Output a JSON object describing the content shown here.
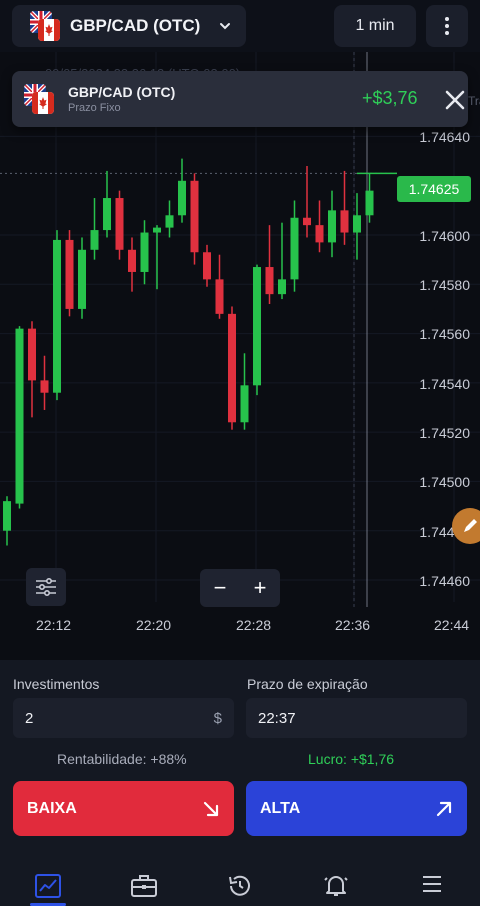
{
  "topbar": {
    "pair_title": "GBP/CAD (OTC)",
    "timeframe": "1 min",
    "icons": {
      "flags": [
        "uk-flag-icon",
        "canada-flag-icon"
      ],
      "dropdown": "chevron-down-icon",
      "more": "kebab-menu-icon"
    }
  },
  "notification": {
    "pair": "GBP/CAD (OTC)",
    "subtitle": "Prazo Fixo",
    "profit": "+$3,76",
    "faded_header": "09/05/2024 22:36:12 (UTC-03:00)",
    "faded_side": "Tra"
  },
  "chart": {
    "current_price": "1.74625",
    "y_ticks": [
      "1.74640",
      "1.74600",
      "1.74580",
      "1.74560",
      "1.74540",
      "1.74520",
      "1.74500",
      "1.74480",
      "1.74460"
    ],
    "x_ticks": [
      "22:12",
      "22:20",
      "22:28",
      "22:36",
      "22:44"
    ],
    "colors": {
      "up": "#27c24c",
      "down": "#e0313f",
      "price_tag": "#2ab94b"
    },
    "candles": [
      {
        "o": 1.7448,
        "c": 1.74492,
        "h": 1.74494,
        "l": 1.74474
      },
      {
        "o": 1.74491,
        "c": 1.74562,
        "h": 1.74563,
        "l": 1.74489
      },
      {
        "o": 1.74562,
        "c": 1.74541,
        "h": 1.74565,
        "l": 1.74526
      },
      {
        "o": 1.74541,
        "c": 1.74536,
        "h": 1.74551,
        "l": 1.74529
      },
      {
        "o": 1.74536,
        "c": 1.74598,
        "h": 1.74602,
        "l": 1.74533
      },
      {
        "o": 1.74598,
        "c": 1.7457,
        "h": 1.74602,
        "l": 1.74567
      },
      {
        "o": 1.7457,
        "c": 1.74594,
        "h": 1.74599,
        "l": 1.74566
      },
      {
        "o": 1.74594,
        "c": 1.74602,
        "h": 1.74615,
        "l": 1.7459
      },
      {
        "o": 1.74602,
        "c": 1.74615,
        "h": 1.74626,
        "l": 1.74599
      },
      {
        "o": 1.74615,
        "c": 1.74594,
        "h": 1.74618,
        "l": 1.7459
      },
      {
        "o": 1.74594,
        "c": 1.74585,
        "h": 1.74599,
        "l": 1.74577
      },
      {
        "o": 1.74585,
        "c": 1.74601,
        "h": 1.74606,
        "l": 1.7458
      },
      {
        "o": 1.74601,
        "c": 1.74603,
        "h": 1.74604,
        "l": 1.74578
      },
      {
        "o": 1.74603,
        "c": 1.74608,
        "h": 1.74614,
        "l": 1.74599
      },
      {
        "o": 1.74608,
        "c": 1.74622,
        "h": 1.74631,
        "l": 1.74605
      },
      {
        "o": 1.74622,
        "c": 1.74593,
        "h": 1.74625,
        "l": 1.74588
      },
      {
        "o": 1.74593,
        "c": 1.74582,
        "h": 1.74596,
        "l": 1.74579
      },
      {
        "o": 1.74582,
        "c": 1.74568,
        "h": 1.74592,
        "l": 1.74566
      },
      {
        "o": 1.74568,
        "c": 1.74524,
        "h": 1.74571,
        "l": 1.74521
      },
      {
        "o": 1.74524,
        "c": 1.74539,
        "h": 1.74552,
        "l": 1.74521
      },
      {
        "o": 1.74539,
        "c": 1.74587,
        "h": 1.74588,
        "l": 1.74535
      },
      {
        "o": 1.74587,
        "c": 1.74576,
        "h": 1.74604,
        "l": 1.74572
      },
      {
        "o": 1.74576,
        "c": 1.74582,
        "h": 1.74605,
        "l": 1.74574
      },
      {
        "o": 1.74582,
        "c": 1.74607,
        "h": 1.74614,
        "l": 1.74577
      },
      {
        "o": 1.74607,
        "c": 1.74604,
        "h": 1.74628,
        "l": 1.74599
      },
      {
        "o": 1.74604,
        "c": 1.74597,
        "h": 1.74614,
        "l": 1.74593
      },
      {
        "o": 1.74597,
        "c": 1.7461,
        "h": 1.74618,
        "l": 1.74591
      },
      {
        "o": 1.7461,
        "c": 1.74601,
        "h": 1.74626,
        "l": 1.74596
      },
      {
        "o": 1.74601,
        "c": 1.74608,
        "h": 1.74617,
        "l": 1.7459
      },
      {
        "o": 1.74608,
        "c": 1.74618,
        "h": 1.74625,
        "l": 1.74605
      }
    ]
  },
  "controls": {
    "zoom_out": "−",
    "zoom_in": "+"
  },
  "trade": {
    "investment_label": "Investimentos",
    "investment_value": "2",
    "investment_suffix": "$",
    "expiry_label": "Prazo de expiração",
    "expiry_value": "22:37",
    "profitability_label": "Rentabilidade:",
    "profitability_value": "+88%",
    "profit_label": "Lucro:",
    "profit_value": "+$1,76",
    "sell_label": "BAIXA",
    "buy_label": "ALTA",
    "colors": {
      "sell": "#e12b3c",
      "buy": "#2b43d8",
      "profit": "#2fcf58"
    }
  },
  "bottom_nav": [
    {
      "icon": "chart-icon",
      "active": true
    },
    {
      "icon": "briefcase-icon",
      "active": false
    },
    {
      "icon": "history-icon",
      "active": false
    },
    {
      "icon": "bell-icon",
      "active": false
    },
    {
      "icon": "menu-icon",
      "active": false
    }
  ]
}
